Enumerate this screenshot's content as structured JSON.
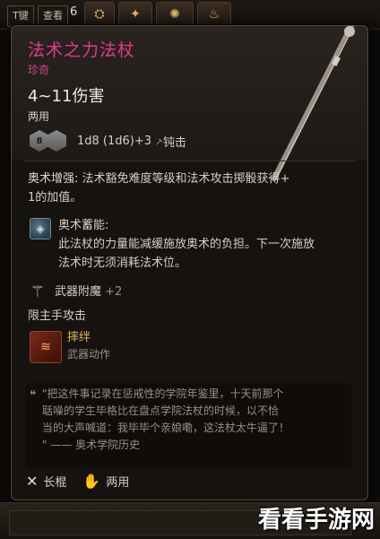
{
  "topbar": {
    "key_hint": "T键",
    "inspect_label": "查看",
    "count": "6"
  },
  "item": {
    "name": "法术之力法杖",
    "rarity": "珍奇",
    "damage": "4~11伤害",
    "handedness": "两用",
    "dice_main": "8",
    "dice_text": "1d8 (1d6)+3",
    "damage_type": "钝击"
  },
  "passive": {
    "title": "奥术增强:",
    "text_line1": "法术豁免难度等级和法术攻击掷骰获得+",
    "text_line2": "1的加值。"
  },
  "arcane": {
    "title": "奥术蓄能:",
    "line1": "此法杖的力量能减缓施放奥术的负担。下一次施放",
    "line2": "法术时无须消耗法术位。"
  },
  "enchant": {
    "label": "武器附魔",
    "value": "+2"
  },
  "restriction": "限主手攻击",
  "action": {
    "name": "摔绊",
    "type": "武器动作"
  },
  "lore": {
    "line1": "\"把这件事记录在惩戒性的学院年鉴里，十天前那个",
    "line2": "聒噪的学生毕格比在盘点学院法杖的时候，以不恰",
    "line3": "当的大声喊道：我毕毕个亲娘嘞，这法杖太牛逼了！",
    "line4": "\" —— 奥术学院历史"
  },
  "footer": {
    "weapon_type": "长棍",
    "hands": "两用"
  },
  "watermark": "看看手游网",
  "colors": {
    "rare_name": "#e23b8d",
    "panel_bg": "#16120f"
  }
}
